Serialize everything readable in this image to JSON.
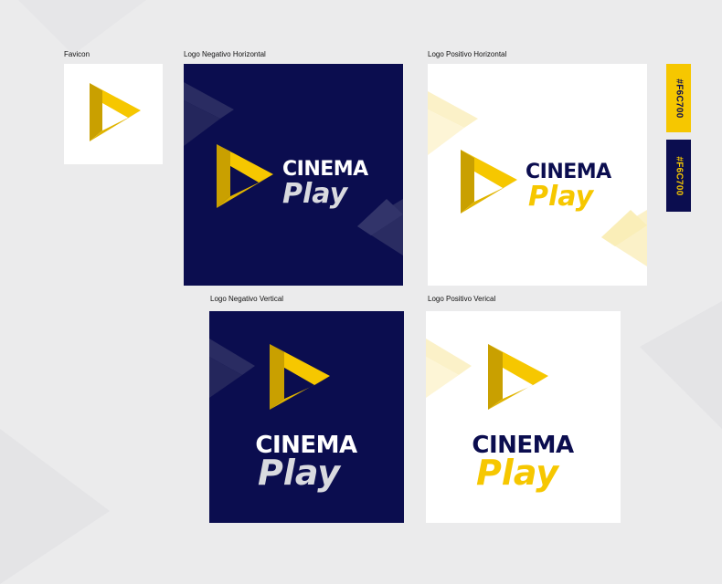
{
  "labels": {
    "favicon": "Favicon",
    "neg_horizontal": "Logo Negativo Horizontal",
    "pos_horizontal": "Logo Positivo Horizontal",
    "neg_vertical": "Logo Negativo Vertical",
    "pos_vertical": "Logo Positivo Verical"
  },
  "brand": {
    "word1": "CINEMA",
    "word2": "Play"
  },
  "swatches": [
    {
      "label": "#F6C700",
      "color": "#F6C700",
      "text_color": "#0b0d4f"
    },
    {
      "label": "#F6C700",
      "color": "#0b0d4f",
      "text_color": "#F6C700"
    }
  ],
  "colors": {
    "yellow": "#F6C700",
    "yellow_dark": "#c9a000",
    "navy": "#0b0d4f",
    "light_gray_text": "#d9dadf",
    "page_bg": "#ebebec"
  },
  "icons": {
    "logo_mark": "play-triangle-icon"
  }
}
